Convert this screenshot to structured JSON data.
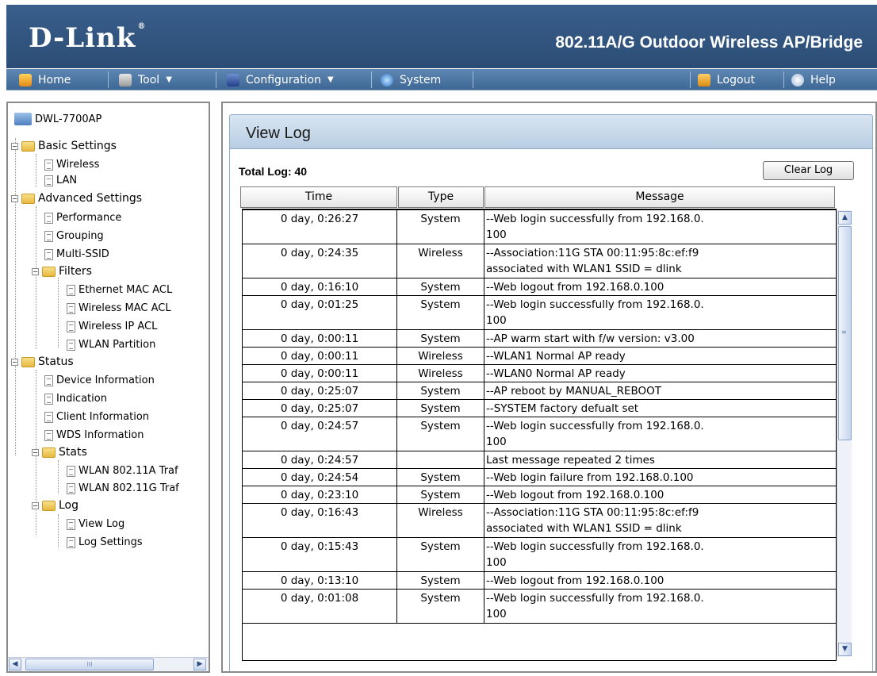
{
  "header": {
    "brand": "D-Link",
    "product_title": "802.11A/G Outdoor Wireless AP/Bridge"
  },
  "menu": {
    "home": "Home",
    "tool": "Tool",
    "configuration": "Configuration",
    "system": "System",
    "logout": "Logout",
    "help": "Help"
  },
  "tree": {
    "root": "DWL-7700AP",
    "basic_settings": "Basic Settings",
    "wireless": "Wireless",
    "lan": "LAN",
    "advanced_settings": "Advanced Settings",
    "performance": "Performance",
    "grouping": "Grouping",
    "multi_ssid": "Multi-SSID",
    "filters": "Filters",
    "ethernet_mac_acl": "Ethernet MAC ACL",
    "wireless_mac_acl": "Wireless MAC ACL",
    "wireless_ip_acl": "Wireless IP ACL",
    "wlan_partition": "WLAN Partition",
    "status": "Status",
    "device_information": "Device Information",
    "indication": "Indication",
    "client_information": "Client Information",
    "wds_information": "WDS Information",
    "stats": "Stats",
    "wlan_a_traf": "WLAN 802.11A Traf",
    "wlan_g_traf": "WLAN 802.11G Traf",
    "log": "Log",
    "view_log": "View Log",
    "log_settings": "Log Settings"
  },
  "main": {
    "title": "View Log",
    "total_log_label": "Total Log:",
    "total_log_value": "40",
    "clear_button": "Clear Log",
    "columns": {
      "time": "Time",
      "type": "Type",
      "message": "Message"
    },
    "rows": [
      {
        "time": "0 day, 0:26:27",
        "type": "System",
        "message": "--Web login successfully from 192.168.0.\n100"
      },
      {
        "time": "0 day, 0:24:35",
        "type": "Wireless",
        "message": "--Association:11G STA 00:11:95:8c:ef:f9\nassociated with WLAN1 SSID = dlink"
      },
      {
        "time": "0 day, 0:16:10",
        "type": "System",
        "message": "--Web logout from 192.168.0.100"
      },
      {
        "time": "0 day, 0:01:25",
        "type": "System",
        "message": "--Web login successfully from 192.168.0.\n100"
      },
      {
        "time": "0 day, 0:00:11",
        "type": "System",
        "message": "--AP warm start with f/w version: v3.00"
      },
      {
        "time": "0 day, 0:00:11",
        "type": "Wireless",
        "message": "--WLAN1 Normal AP ready"
      },
      {
        "time": "0 day, 0:00:11",
        "type": "Wireless",
        "message": "--WLAN0 Normal AP ready"
      },
      {
        "time": "0 day, 0:25:07",
        "type": "System",
        "message": "--AP reboot by MANUAL_REBOOT"
      },
      {
        "time": "0 day, 0:25:07",
        "type": "System",
        "message": "--SYSTEM factory defualt set"
      },
      {
        "time": "0 day, 0:24:57",
        "type": "System",
        "message": "--Web login successfully from 192.168.0.\n100"
      },
      {
        "time": "0 day, 0:24:57",
        "type": "",
        "message": "Last message repeated 2 times"
      },
      {
        "time": "0 day, 0:24:54",
        "type": "System",
        "message": "--Web login failure from 192.168.0.100"
      },
      {
        "time": "0 day, 0:23:10",
        "type": "System",
        "message": "--Web logout from 192.168.0.100"
      },
      {
        "time": "0 day, 0:16:43",
        "type": "Wireless",
        "message": "--Association:11G STA 00:11:95:8c:ef:f9\nassociated with WLAN1 SSID = dlink"
      },
      {
        "time": "0 day, 0:15:43",
        "type": "System",
        "message": "--Web login successfully from 192.168.0.\n100"
      },
      {
        "time": "0 day, 0:13:10",
        "type": "System",
        "message": "--Web logout from 192.168.0.100"
      },
      {
        "time": "0 day, 0:01:08",
        "type": "System",
        "message": "--Web login successfully from 192.168.0.\n100"
      }
    ]
  },
  "colors": {
    "header_bg": "#2b4d75",
    "menu_bg": "#3d6795",
    "title_bar_bg": "#c7d8ea"
  }
}
